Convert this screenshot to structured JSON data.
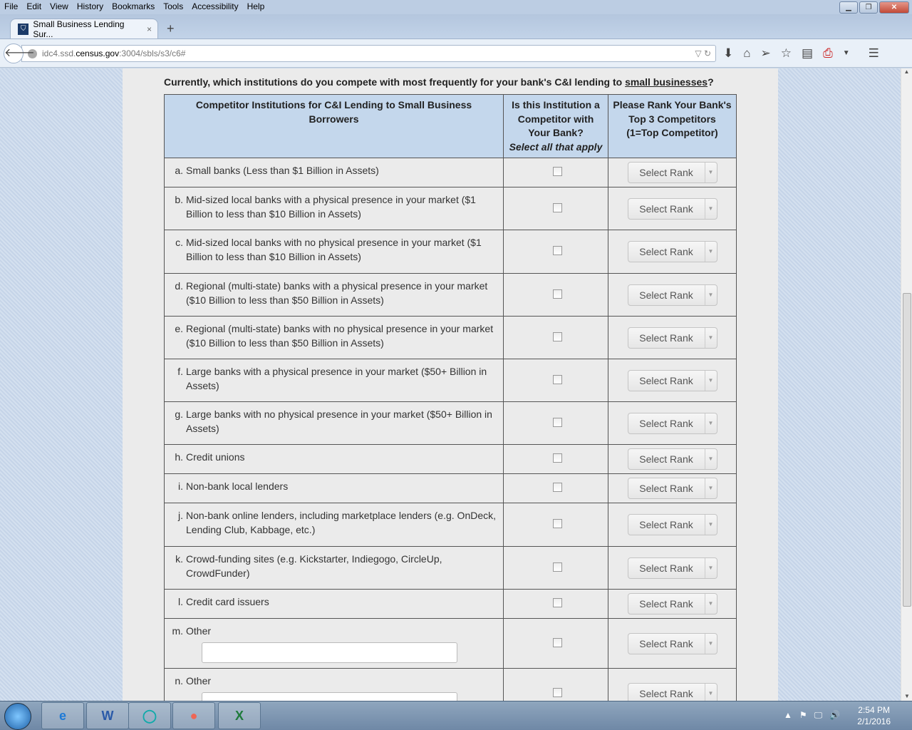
{
  "menu": [
    "File",
    "Edit",
    "View",
    "History",
    "Bookmarks",
    "Tools",
    "Accessibility",
    "Help"
  ],
  "tab": {
    "title": "Small Business Lending Sur...",
    "close": "×",
    "new": "+"
  },
  "url": {
    "prefix": "idc4.ssd.",
    "domain": "census.gov",
    "suffix": ":3004/sbls/s3/c6#"
  },
  "question": {
    "text": "Currently, which institutions do you compete with most frequently for your bank's C&I lending to ",
    "link": "small businesses",
    "end": "?"
  },
  "headers": {
    "col1": "Competitor Institutions for C&I Lending to Small Business Borrowers",
    "col2": "Is this Institution a Competitor with Your Bank?",
    "col2_note": "Select all that apply",
    "col3": "Please Rank Your Bank's Top 3 Competitors (1=Top Competitor)"
  },
  "select_label": "Select Rank",
  "rows": [
    {
      "letter": "a.",
      "text": "Small banks (Less than $1 Billion in Assets)"
    },
    {
      "letter": "b.",
      "text": "Mid-sized local banks with a physical presence in your market ($1 Billion to less than $10 Billion in Assets)"
    },
    {
      "letter": "c.",
      "text": "Mid-sized local banks with no physical presence in your market ($1 Billion to less than $10 Billion in Assets)"
    },
    {
      "letter": "d.",
      "text": "Regional (multi-state) banks with a physical presence in your market ($10 Billion to less than $50 Billion in Assets)"
    },
    {
      "letter": "e.",
      "text": "Regional (multi-state) banks with no physical presence in your market ($10 Billion to less than $50 Billion in Assets)"
    },
    {
      "letter": "f.",
      "text": "Large banks with a physical presence in your market ($50+ Billion in Assets)"
    },
    {
      "letter": "g.",
      "text": "Large banks with no physical presence in your market ($50+ Billion in Assets)"
    },
    {
      "letter": "h.",
      "text": "Credit unions"
    },
    {
      "letter": "i.",
      "text": "Non-bank local lenders"
    },
    {
      "letter": "j.",
      "text": "Non-bank online lenders, including marketplace lenders (e.g. OnDeck, Lending Club, Kabbage, etc.)"
    },
    {
      "letter": "k.",
      "text": "Crowd-funding sites (e.g. Kickstarter, Indiegogo, CircleUp, CrowdFunder)"
    },
    {
      "letter": "l.",
      "text": "Credit card issuers"
    },
    {
      "letter": "m.",
      "text": "Other",
      "input": ""
    },
    {
      "letter": "n.",
      "text": "Other",
      "input": ""
    }
  ],
  "clock": {
    "time": "2:54 PM",
    "date": "2/1/2016"
  }
}
